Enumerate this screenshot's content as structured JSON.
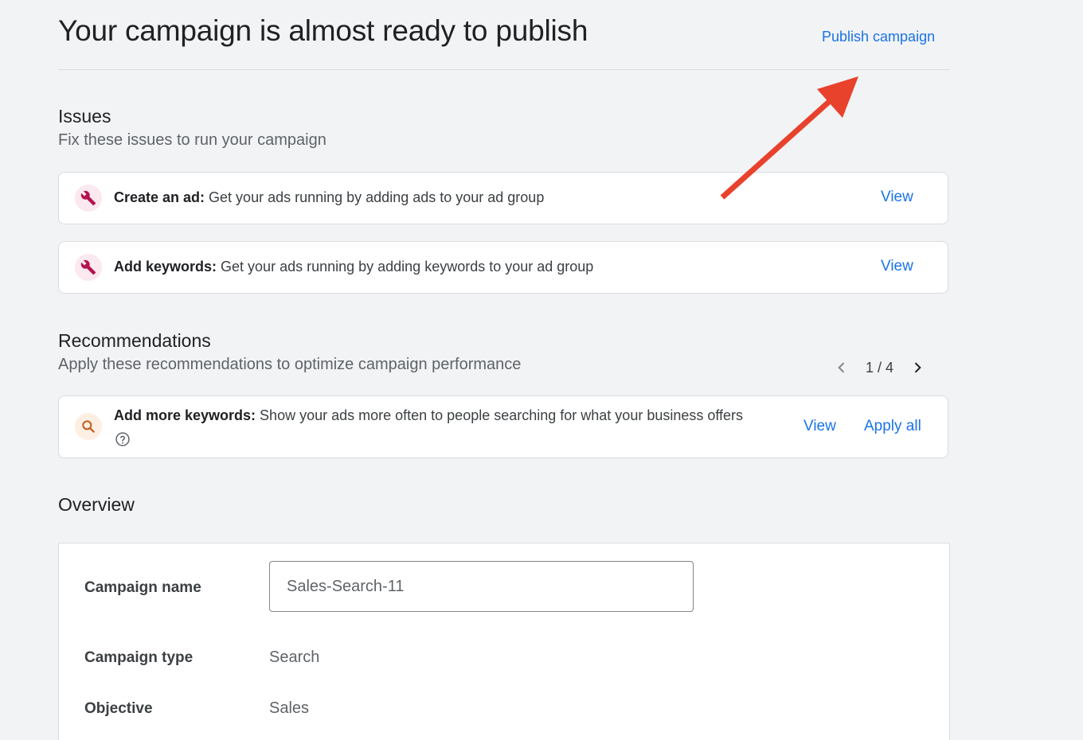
{
  "header": {
    "title": "Your campaign is almost ready to publish",
    "publish_label": "Publish campaign"
  },
  "issues": {
    "title": "Issues",
    "subtitle": "Fix these issues to run your campaign",
    "items": [
      {
        "bold": "Create an ad:",
        "text": " Get your ads running by adding ads to your ad group",
        "action": "View"
      },
      {
        "bold": "Add keywords:",
        "text": " Get your ads running by adding keywords to your ad group",
        "action": "View"
      }
    ]
  },
  "recommendations": {
    "title": "Recommendations",
    "subtitle": "Apply these recommendations to optimize campaign performance",
    "pager": "1 / 4",
    "items": [
      {
        "bold": "Add more keywords:",
        "text": " Show your ads more often to people searching for what your business offers",
        "view": "View",
        "apply": "Apply all"
      }
    ]
  },
  "overview": {
    "title": "Overview",
    "campaign_name_label": "Campaign name",
    "campaign_name_value": "Sales-Search-11",
    "campaign_type_label": "Campaign type",
    "campaign_type_value": "Search",
    "objective_label": "Objective",
    "objective_value": "Sales"
  },
  "colors": {
    "accent": "#1a73e8",
    "issue_icon": "#b3124f",
    "rec_icon": "#c5581c",
    "arrow": "#e8412c"
  },
  "icons": {
    "issue": "wrench-icon",
    "recommendation": "search-icon",
    "help": "help-circle-icon",
    "prev": "chevron-left-icon",
    "next": "chevron-right-icon"
  }
}
